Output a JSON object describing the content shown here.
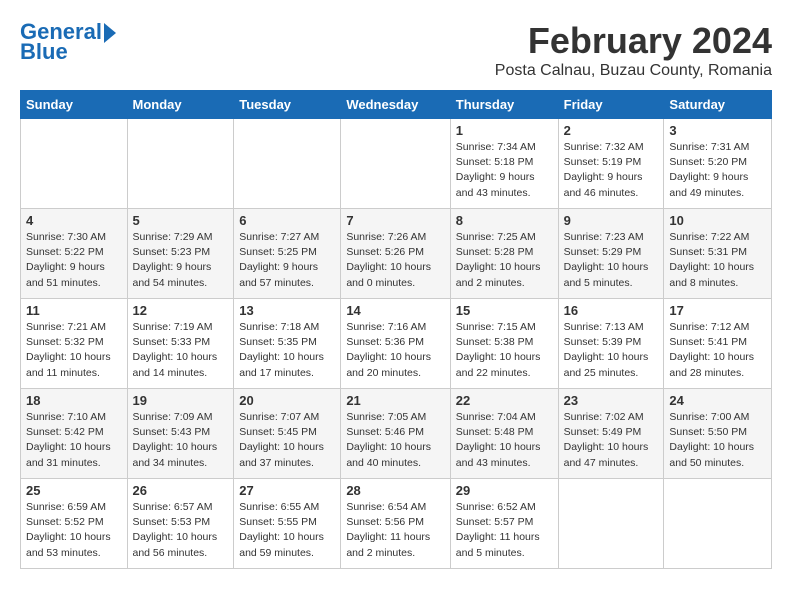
{
  "header": {
    "logo_line1": "General",
    "logo_line2": "Blue",
    "month_year": "February 2024",
    "location": "Posta Calnau, Buzau County, Romania"
  },
  "weekdays": [
    "Sunday",
    "Monday",
    "Tuesday",
    "Wednesday",
    "Thursday",
    "Friday",
    "Saturday"
  ],
  "weeks": [
    [
      {
        "day": "",
        "info": ""
      },
      {
        "day": "",
        "info": ""
      },
      {
        "day": "",
        "info": ""
      },
      {
        "day": "",
        "info": ""
      },
      {
        "day": "1",
        "info": "Sunrise: 7:34 AM\nSunset: 5:18 PM\nDaylight: 9 hours and 43 minutes."
      },
      {
        "day": "2",
        "info": "Sunrise: 7:32 AM\nSunset: 5:19 PM\nDaylight: 9 hours and 46 minutes."
      },
      {
        "day": "3",
        "info": "Sunrise: 7:31 AM\nSunset: 5:20 PM\nDaylight: 9 hours and 49 minutes."
      }
    ],
    [
      {
        "day": "4",
        "info": "Sunrise: 7:30 AM\nSunset: 5:22 PM\nDaylight: 9 hours and 51 minutes."
      },
      {
        "day": "5",
        "info": "Sunrise: 7:29 AM\nSunset: 5:23 PM\nDaylight: 9 hours and 54 minutes."
      },
      {
        "day": "6",
        "info": "Sunrise: 7:27 AM\nSunset: 5:25 PM\nDaylight: 9 hours and 57 minutes."
      },
      {
        "day": "7",
        "info": "Sunrise: 7:26 AM\nSunset: 5:26 PM\nDaylight: 10 hours and 0 minutes."
      },
      {
        "day": "8",
        "info": "Sunrise: 7:25 AM\nSunset: 5:28 PM\nDaylight: 10 hours and 2 minutes."
      },
      {
        "day": "9",
        "info": "Sunrise: 7:23 AM\nSunset: 5:29 PM\nDaylight: 10 hours and 5 minutes."
      },
      {
        "day": "10",
        "info": "Sunrise: 7:22 AM\nSunset: 5:31 PM\nDaylight: 10 hours and 8 minutes."
      }
    ],
    [
      {
        "day": "11",
        "info": "Sunrise: 7:21 AM\nSunset: 5:32 PM\nDaylight: 10 hours and 11 minutes."
      },
      {
        "day": "12",
        "info": "Sunrise: 7:19 AM\nSunset: 5:33 PM\nDaylight: 10 hours and 14 minutes."
      },
      {
        "day": "13",
        "info": "Sunrise: 7:18 AM\nSunset: 5:35 PM\nDaylight: 10 hours and 17 minutes."
      },
      {
        "day": "14",
        "info": "Sunrise: 7:16 AM\nSunset: 5:36 PM\nDaylight: 10 hours and 20 minutes."
      },
      {
        "day": "15",
        "info": "Sunrise: 7:15 AM\nSunset: 5:38 PM\nDaylight: 10 hours and 22 minutes."
      },
      {
        "day": "16",
        "info": "Sunrise: 7:13 AM\nSunset: 5:39 PM\nDaylight: 10 hours and 25 minutes."
      },
      {
        "day": "17",
        "info": "Sunrise: 7:12 AM\nSunset: 5:41 PM\nDaylight: 10 hours and 28 minutes."
      }
    ],
    [
      {
        "day": "18",
        "info": "Sunrise: 7:10 AM\nSunset: 5:42 PM\nDaylight: 10 hours and 31 minutes."
      },
      {
        "day": "19",
        "info": "Sunrise: 7:09 AM\nSunset: 5:43 PM\nDaylight: 10 hours and 34 minutes."
      },
      {
        "day": "20",
        "info": "Sunrise: 7:07 AM\nSunset: 5:45 PM\nDaylight: 10 hours and 37 minutes."
      },
      {
        "day": "21",
        "info": "Sunrise: 7:05 AM\nSunset: 5:46 PM\nDaylight: 10 hours and 40 minutes."
      },
      {
        "day": "22",
        "info": "Sunrise: 7:04 AM\nSunset: 5:48 PM\nDaylight: 10 hours and 43 minutes."
      },
      {
        "day": "23",
        "info": "Sunrise: 7:02 AM\nSunset: 5:49 PM\nDaylight: 10 hours and 47 minutes."
      },
      {
        "day": "24",
        "info": "Sunrise: 7:00 AM\nSunset: 5:50 PM\nDaylight: 10 hours and 50 minutes."
      }
    ],
    [
      {
        "day": "25",
        "info": "Sunrise: 6:59 AM\nSunset: 5:52 PM\nDaylight: 10 hours and 53 minutes."
      },
      {
        "day": "26",
        "info": "Sunrise: 6:57 AM\nSunset: 5:53 PM\nDaylight: 10 hours and 56 minutes."
      },
      {
        "day": "27",
        "info": "Sunrise: 6:55 AM\nSunset: 5:55 PM\nDaylight: 10 hours and 59 minutes."
      },
      {
        "day": "28",
        "info": "Sunrise: 6:54 AM\nSunset: 5:56 PM\nDaylight: 11 hours and 2 minutes."
      },
      {
        "day": "29",
        "info": "Sunrise: 6:52 AM\nSunset: 5:57 PM\nDaylight: 11 hours and 5 minutes."
      },
      {
        "day": "",
        "info": ""
      },
      {
        "day": "",
        "info": ""
      }
    ]
  ]
}
